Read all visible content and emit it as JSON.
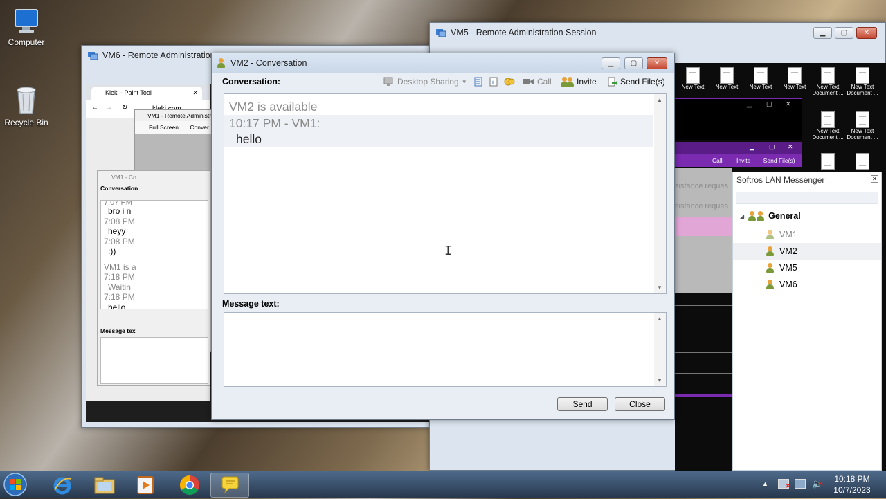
{
  "desktop": {
    "icons": [
      {
        "label": "Computer",
        "icon": "computer-icon"
      },
      {
        "label": "Recycle Bin",
        "icon": "recycle-bin-icon"
      }
    ]
  },
  "vm6_window": {
    "title": "VM6 - Remote Administration",
    "browser_tab": "Kleki - Paint Tool",
    "browser_url": "kleki.com",
    "inner_title": "VM1 - Remote Administra",
    "inner_toolbar": [
      "Full Screen",
      "Conver"
    ],
    "inner_conv_title": "VM1 - Co",
    "inner_conv_label": "Conversation",
    "inner_lines": [
      "7:07 PM",
      "bro i n",
      "7:08 PM",
      "heyy",
      "7:08 PM",
      ":))",
      "VM1 is a",
      "7:18 PM",
      "Waitin",
      "7:18 PM",
      "hello"
    ],
    "inner_message_label": "Message tex"
  },
  "vm5_window": {
    "title": "VM5 - Remote Administration Session",
    "files": [
      "New Text",
      "New Text",
      "New Text",
      "New Text",
      "New Text Document ...",
      "New Text Document ...",
      "New Text Document ...",
      "New Text Document ..."
    ],
    "inner_toolbar": [
      "Call",
      "Invite",
      "Send File(s)"
    ],
    "assist_lines": [
      "sistance reques",
      "sistance reques"
    ]
  },
  "messenger": {
    "title": "Softros LAN Messenger",
    "group": "General",
    "users": [
      "VM1",
      "VM2",
      "VM5",
      "VM6"
    ],
    "selected_user": "VM2",
    "offline_user": "VM1"
  },
  "conversation": {
    "title": "VM2 - Conversation",
    "conversation_label": "Conversation:",
    "toolbar": {
      "desktop_sharing": "Desktop Sharing",
      "call": "Call",
      "invite": "Invite",
      "send_files": "Send File(s)"
    },
    "status_line": "VM2 is available",
    "message_header": "10:17 PM - VM1:",
    "message_body": "hello",
    "message_text_label": "Message text:",
    "message_input_value": "",
    "send_button": "Send",
    "close_button": "Close"
  },
  "taskbar": {
    "time": "10:18 PM",
    "date": "10/7/2023",
    "apps": [
      "start-orb-icon",
      "internet-explorer-icon",
      "file-explorer-icon",
      "media-player-icon",
      "chrome-icon",
      "softros-messenger-icon"
    ]
  },
  "colors": {
    "accent": "#3b7ed6",
    "purple": "#7a2bb0",
    "pink": "#e2a6d6"
  }
}
